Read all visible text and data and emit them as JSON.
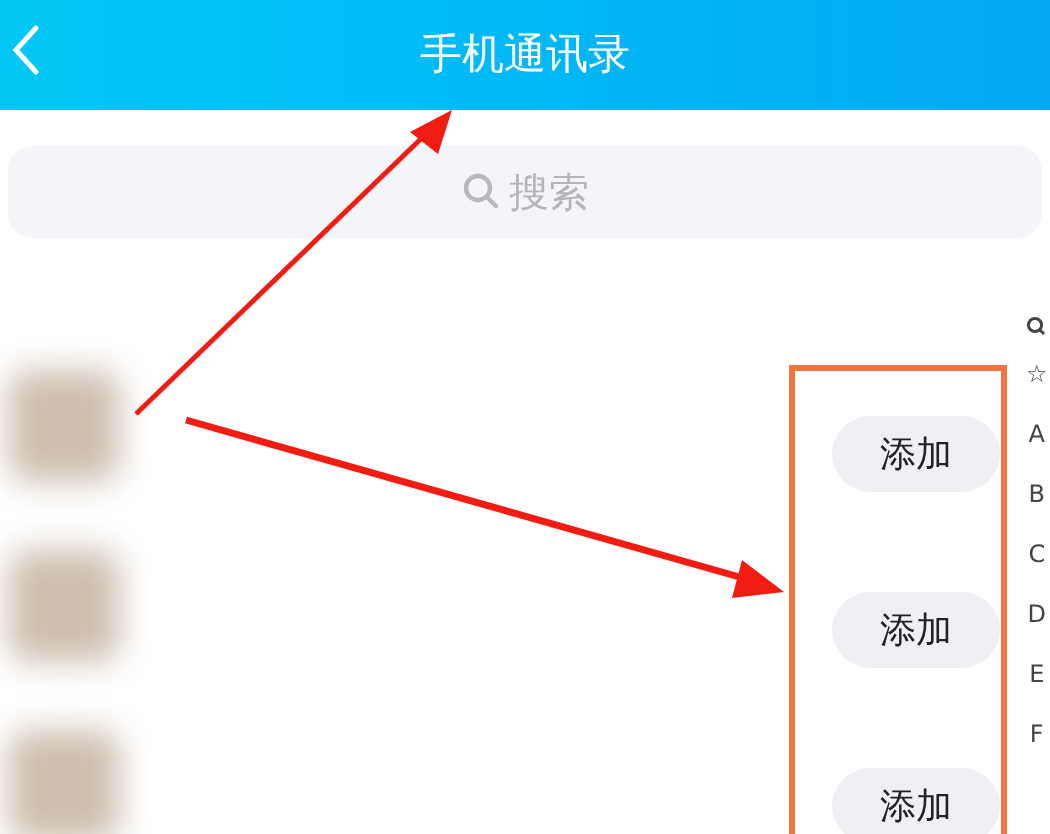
{
  "header": {
    "title": "手机通讯录"
  },
  "search": {
    "placeholder": "搜索"
  },
  "contacts": [
    {
      "button": "添加"
    },
    {
      "button": "添加"
    },
    {
      "button": "添加"
    }
  ],
  "index": [
    "☆",
    "A",
    "B",
    "C",
    "D",
    "E",
    "F"
  ]
}
